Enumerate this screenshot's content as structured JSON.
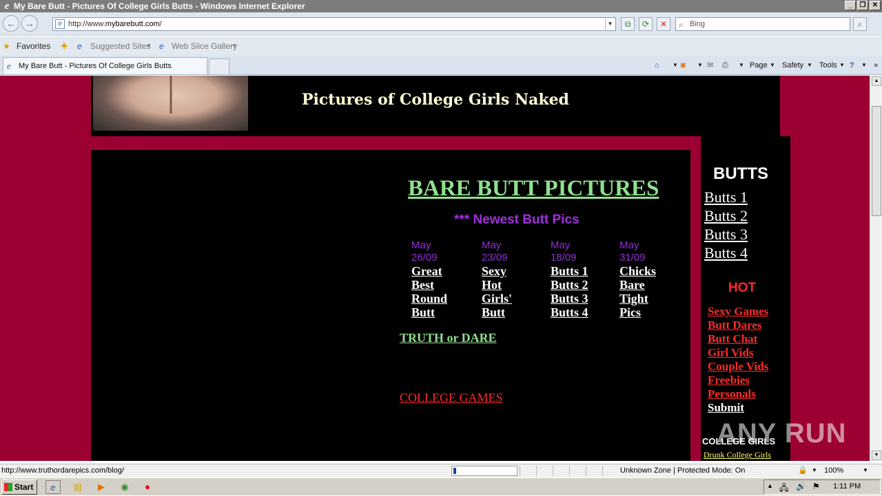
{
  "window": {
    "title": "My Bare Butt - Pictures Of College Girls Butts - Windows Internet Explorer"
  },
  "toolbar": {
    "url_prefix": "http://www.",
    "url_domain": "mybarebutt.com",
    "url_suffix": "/",
    "search_placeholder": "Bing"
  },
  "favorites": {
    "label": "Favorites",
    "suggested": "Suggested Sites",
    "gallery": "Web Slice Gallery"
  },
  "tab": {
    "title": "My Bare Butt - Pictures Of College Girls Butts"
  },
  "commands": {
    "page": "Page",
    "safety": "Safety",
    "tools": "Tools"
  },
  "page": {
    "header_title": "Pictures of College Girls Naked",
    "main_title": "BARE BUTT PICTURES",
    "newest": "*** Newest Butt Pics",
    "columns": [
      {
        "month": "May",
        "date": "26/09",
        "links": [
          "Great",
          "Best",
          "Round",
          "Butt"
        ]
      },
      {
        "month": "May",
        "date": "23/09",
        "links": [
          "Sexy",
          "Hot",
          "Girls'",
          "Butt"
        ]
      },
      {
        "month": "May",
        "date": "18/09",
        "links": [
          "Butts 1",
          "Butts 2",
          "Butts 3",
          "Butts 4"
        ]
      },
      {
        "month": "May",
        "date": "31/09",
        "links": [
          "Chicks",
          "Bare",
          "Tight",
          "Pics"
        ]
      }
    ],
    "truth_link": "TRUTH or DARE",
    "college_link": "COLLEGE GAMES"
  },
  "sidebar": {
    "heading": "BUTTS",
    "butts": [
      "Butts 1",
      "Butts 2",
      "Butts 3",
      "Butts 4"
    ],
    "hot_heading": "HOT",
    "hot_links": [
      "Sexy Games",
      "Butt Dares",
      "Butt Chat",
      "Girl Vids",
      "Couple Vids",
      "Freebies",
      "Personals"
    ],
    "submit": "Submit",
    "college_heading": "COLLEGE GIRLS",
    "drunk_link": "Drunk College Girls"
  },
  "watermark": "ANY RUN",
  "status": {
    "url": "http://www.truthordarepics.com/blog/",
    "zone": "Unknown Zone | Protected Mode: On",
    "zoom": "100%"
  },
  "taskbar": {
    "start": "Start",
    "time": "1:11 PM"
  }
}
